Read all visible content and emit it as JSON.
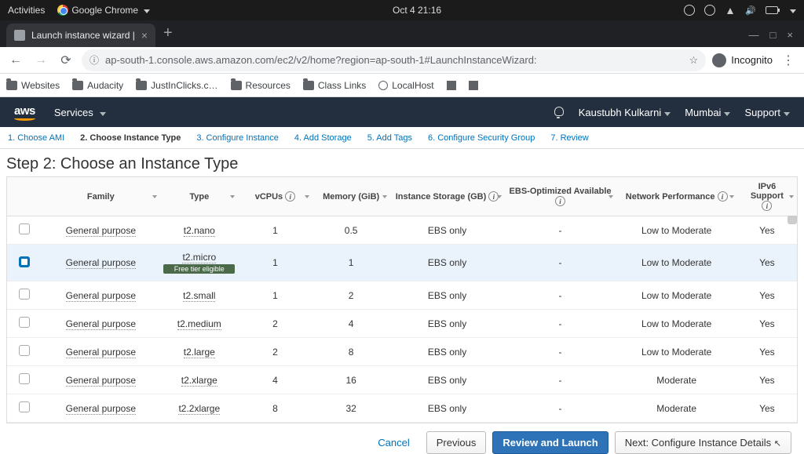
{
  "gnome": {
    "activities": "Activities",
    "app": "Google Chrome",
    "clock": "Oct 4  21:16"
  },
  "chrome": {
    "tab_title": "Launch instance wizard |",
    "url": "ap-south-1.console.aws.amazon.com/ec2/v2/home?region=ap-south-1#LaunchInstanceWizard:",
    "incognito": "Incognito",
    "bookmarks": [
      "Websites",
      "Audacity",
      "JustInClicks.c…",
      "Resources",
      "Class Links",
      "LocalHost"
    ]
  },
  "aws": {
    "logo": "aws",
    "services": "Services",
    "user": "Kaustubh Kulkarni",
    "region": "Mumbai",
    "support": "Support"
  },
  "wizard_tabs": [
    "1. Choose AMI",
    "2. Choose Instance Type",
    "3. Configure Instance",
    "4. Add Storage",
    "5. Add Tags",
    "6. Configure Security Group",
    "7. Review"
  ],
  "heading": "Step 2: Choose an Instance Type",
  "columns": {
    "family": "Family",
    "type": "Type",
    "vcpus": "vCPUs",
    "memory": "Memory (GiB)",
    "storage": "Instance Storage (GB)",
    "ebs": "EBS-Optimized Available",
    "net": "Network Performance",
    "ipv6_a": "IPv6",
    "ipv6_b": "Support"
  },
  "free_tier_label": "Free tier eligible",
  "rows": [
    {
      "selected": false,
      "family": "General purpose",
      "type": "t2.nano",
      "free": false,
      "vcpus": "1",
      "mem": "0.5",
      "storage": "EBS only",
      "ebs": "-",
      "net": "Low to Moderate",
      "ipv6": "Yes"
    },
    {
      "selected": true,
      "family": "General purpose",
      "type": "t2.micro",
      "free": true,
      "vcpus": "1",
      "mem": "1",
      "storage": "EBS only",
      "ebs": "-",
      "net": "Low to Moderate",
      "ipv6": "Yes"
    },
    {
      "selected": false,
      "family": "General purpose",
      "type": "t2.small",
      "free": false,
      "vcpus": "1",
      "mem": "2",
      "storage": "EBS only",
      "ebs": "-",
      "net": "Low to Moderate",
      "ipv6": "Yes"
    },
    {
      "selected": false,
      "family": "General purpose",
      "type": "t2.medium",
      "free": false,
      "vcpus": "2",
      "mem": "4",
      "storage": "EBS only",
      "ebs": "-",
      "net": "Low to Moderate",
      "ipv6": "Yes"
    },
    {
      "selected": false,
      "family": "General purpose",
      "type": "t2.large",
      "free": false,
      "vcpus": "2",
      "mem": "8",
      "storage": "EBS only",
      "ebs": "-",
      "net": "Low to Moderate",
      "ipv6": "Yes"
    },
    {
      "selected": false,
      "family": "General purpose",
      "type": "t2.xlarge",
      "free": false,
      "vcpus": "4",
      "mem": "16",
      "storage": "EBS only",
      "ebs": "-",
      "net": "Moderate",
      "ipv6": "Yes"
    },
    {
      "selected": false,
      "family": "General purpose",
      "type": "t2.2xlarge",
      "free": false,
      "vcpus": "8",
      "mem": "32",
      "storage": "EBS only",
      "ebs": "-",
      "net": "Moderate",
      "ipv6": "Yes"
    }
  ],
  "buttons": {
    "cancel": "Cancel",
    "previous": "Previous",
    "review": "Review and Launch",
    "next": "Next: Configure Instance Details"
  }
}
